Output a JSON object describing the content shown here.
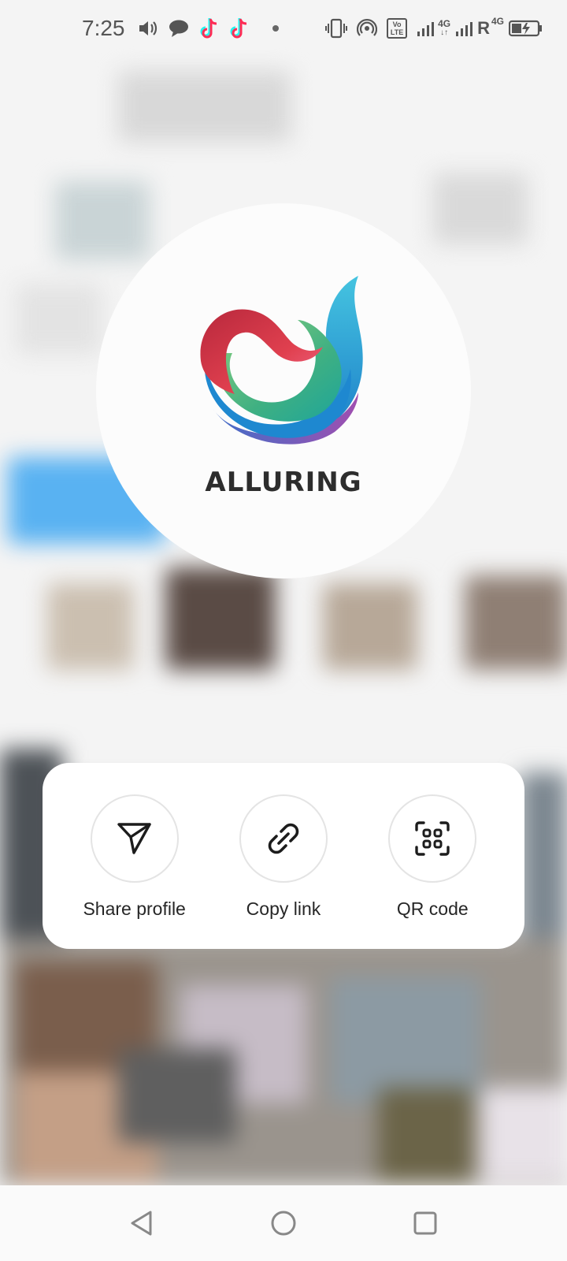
{
  "status_bar": {
    "time": "7:25",
    "left_icons": [
      "volume-icon",
      "chat-bubble-icon",
      "tiktok-icon",
      "tiktok-icon",
      "dot-icon"
    ],
    "right_icons": [
      "vibrate-icon",
      "hotspot-icon",
      "volte-icon",
      "signal-4g-icon",
      "signal-roaming-icon",
      "battery-charging-icon"
    ],
    "volte_label": "Vo LTE",
    "network_label_1": "4G",
    "roaming_label": "R",
    "network_label_2": "4G"
  },
  "profile": {
    "brand_name": "ALLURING",
    "logo": "alluring-swirl-logo"
  },
  "actions": [
    {
      "label": "Share profile",
      "icon": "paper-plane-icon"
    },
    {
      "label": "Copy link",
      "icon": "link-icon"
    },
    {
      "label": "QR code",
      "icon": "qr-scan-icon"
    }
  ],
  "nav_bar": {
    "icons": [
      "back-icon",
      "home-icon",
      "recents-icon"
    ]
  },
  "colors": {
    "card_bg": "#ffffff",
    "text_primary": "#262626",
    "brand_text": "#2d2d2d",
    "logo_red": "#e0404f",
    "logo_green": "#5cc07a",
    "logo_blue": "#1e88d0",
    "logo_purple": "#9a4fb5"
  }
}
